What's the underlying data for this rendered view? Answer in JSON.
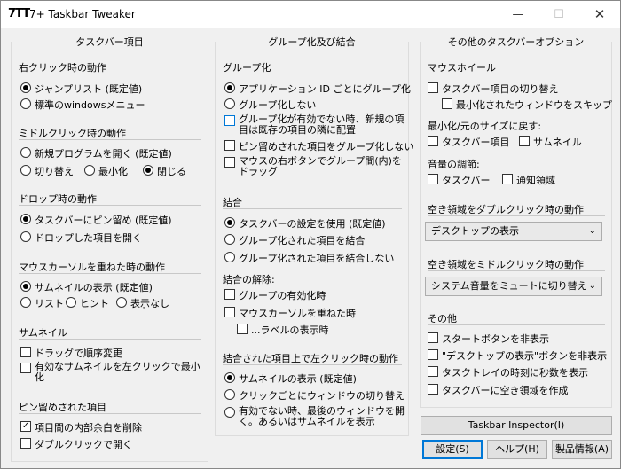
{
  "window": {
    "title": "7+ Taskbar Tweaker",
    "icon": "7TT",
    "controls": {
      "minimize": "—",
      "maximize": "☐",
      "close": "✕"
    }
  },
  "col1": {
    "title": "タスクバー項目",
    "rightclick": {
      "label": "右クリック時の動作",
      "o1": "ジャンプリスト (既定値)",
      "o2": "標準のwindowsメニュー"
    },
    "middleclick": {
      "label": "ミドルクリック時の動作",
      "o1": "新規プログラムを開く (既定値)",
      "o2": "切り替え",
      "o3": "最小化",
      "o4": "閉じる"
    },
    "drop": {
      "label": "ドロップ時の動作",
      "o1": "タスクバーにピン留め (既定値)",
      "o2": "ドロップした項目を開く"
    },
    "hover": {
      "label": "マウスカーソルを重ねた時の動作",
      "o1": "サムネイルの表示 (既定値)",
      "o2": "リスト",
      "o3": "ヒント",
      "o4": "表示なし"
    },
    "thumb": {
      "label": "サムネイル",
      "c1": "ドラッグで順序変更",
      "c2": "有効なサムネイルを左クリックで最小化"
    },
    "pinned": {
      "label": "ピン留めされた項目",
      "c1": "項目間の内部余白を削除",
      "c2": "ダブルクリックで開く"
    }
  },
  "col2": {
    "title": "グループ化及び結合",
    "grouping": {
      "label": "グループ化",
      "o1": "アプリケーション ID ごとにグループ化",
      "o2": "グループ化しない",
      "c1": "グループ化が有効でない時、新規の項目は既存の項目の隣に配置",
      "c2": "ピン留めされた項目をグループ化しない",
      "c3": "マウスの右ボタンでグループ間(内)をドラッグ"
    },
    "combine": {
      "label": "結合",
      "o1": "タスクバーの設定を使用 (既定値)",
      "o2": "グループ化された項目を結合",
      "o3": "グループ化された項目を結合しない"
    },
    "uncombine": {
      "label": "結合の解除:",
      "c1": "グループの有効化時",
      "c2": "マウスカーソルを重ねた時",
      "c3": "...ラベルの表示時"
    },
    "leftclick": {
      "label": "結合された項目上で左クリック時の動作",
      "o1": "サムネイルの表示 (既定値)",
      "o2": "クリックごとにウィンドウの切り替え",
      "o3": "有効でない時、最後のウィンドウを開く。あるいはサムネイルを表示"
    }
  },
  "col3": {
    "title": "その他のタスクバーオプション",
    "wheel": {
      "label": "マウスホイール",
      "c1": "タスクバー項目の切り替え",
      "c2": "最小化されたウィンドウをスキップ"
    },
    "restore": {
      "label": "最小化/元のサイズに戻す:",
      "c1": "タスクバー項目",
      "c2": "サムネイル"
    },
    "volume": {
      "label": "音量の調節:",
      "c1": "タスクバー",
      "c2": "通知領域"
    },
    "dblclick": {
      "label": "空き領域をダブルクリック時の動作",
      "value": "デスクトップの表示"
    },
    "midclick": {
      "label": "空き領域をミドルクリック時の動作",
      "value": "システム音量をミュートに切り替え"
    },
    "other": {
      "label": "その他",
      "c1": "スタートボタンを非表示",
      "c2": "\"デスクトップの表示\"ボタンを非表示",
      "c3": "タスクトレイの時刻に秒数を表示",
      "c4": "タスクバーに空き領域を作成"
    }
  },
  "buttons": {
    "inspector": "Taskbar Inspector(I)",
    "settings": "設定(S)",
    "help": "ヘルプ(H)",
    "about": "製品情報(A)"
  }
}
